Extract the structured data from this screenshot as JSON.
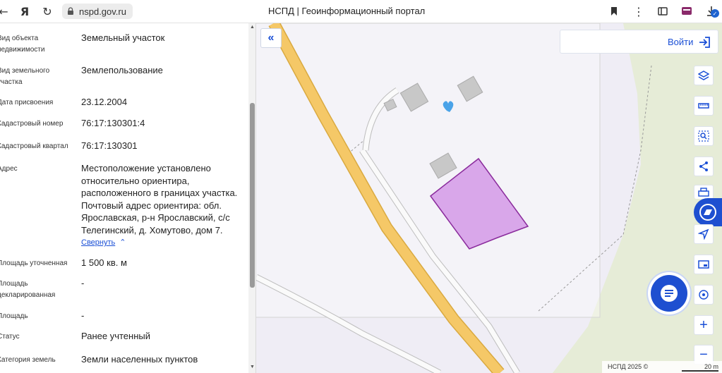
{
  "browser": {
    "url": "nspd.gov.ru",
    "page_title": "НСПД | Геоинформационный портал",
    "ext_badge": "✓",
    "icons": [
      "back-icon",
      "yandex-icon",
      "reload-icon",
      "lock-icon",
      "bookmark-icon",
      "more-icon",
      "extensions-icon",
      "profile-icon",
      "download-icon"
    ]
  },
  "panel": {
    "rows": [
      {
        "label": "Вид объекта недвижимости",
        "value": "Земельный участок"
      },
      {
        "label": "Вид земельного участка",
        "value": "Землепользование"
      },
      {
        "label": "Дата присвоения",
        "value": "23.12.2004"
      },
      {
        "label": "Кадастровый номер",
        "value": "76:17:130301:4"
      },
      {
        "label": "Кадастровый квартал",
        "value": "76:17:130301"
      },
      {
        "label": "Адрес",
        "value": "Местоположение установлено относительно ориентира, расположенного в границах участка. Почтовый адрес ориентира: обл. Ярославская, р-н Ярославский, с/с Телегинский, д. Хомутово, дом 7."
      },
      {
        "label": "Площадь уточненная",
        "value": "1 500 кв. м"
      },
      {
        "label": "Площадь декларированная",
        "value": "-"
      },
      {
        "label": "Площадь",
        "value": "-"
      },
      {
        "label": "Статус",
        "value": "Ранее учтенный"
      },
      {
        "label": "Категория земель",
        "value": "Земли населенных пунктов"
      }
    ],
    "collapse_link": "Свернуть"
  },
  "map": {
    "login_label": "Войти",
    "toolbar": [
      "layers-icon",
      "ruler-icon",
      "search-area-icon",
      "share-icon",
      "print-icon",
      "navigation-icon",
      "window-icon",
      "geolocation-icon",
      "zoom-in-icon",
      "zoom-out-icon"
    ],
    "footer_copy": "НСПД 2025 ©",
    "scale_label": "20 m",
    "accent_color": "#1e4fd0",
    "parcel_color": "#d9a7ea",
    "road_color": "#f2c463"
  }
}
